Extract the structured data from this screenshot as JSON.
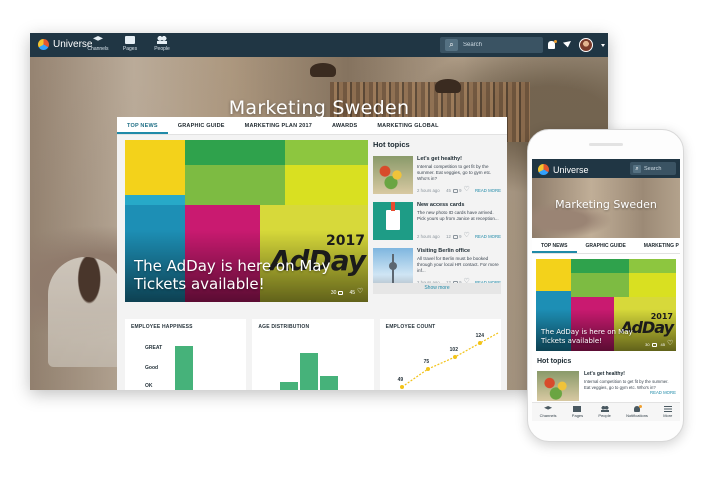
{
  "desktop": {
    "app_name": "Universe",
    "nav": [
      {
        "label": "Channels",
        "icon": "layers-icon"
      },
      {
        "label": "Pages",
        "icon": "book-icon"
      },
      {
        "label": "People",
        "icon": "people-icon"
      }
    ],
    "search": {
      "placeholder": "Search"
    },
    "hero_title": "Marketing Sweden",
    "tabs": [
      {
        "label": "TOP NEWS",
        "active": true
      },
      {
        "label": "GRAPHIC GUIDE"
      },
      {
        "label": "MARKETING PLAN 2017"
      },
      {
        "label": "AWARDS"
      },
      {
        "label": "MARKETING GLOBAL"
      }
    ],
    "feature": {
      "title": "The AdDay is here on May Tickets available!",
      "brand_year": "2017",
      "brand_word": "AdDay",
      "comments": "30",
      "likes": "45"
    },
    "hot_topics": {
      "title": "Hot topics",
      "items": [
        {
          "title": "Let's get healthy!",
          "text": "Internal competition to get fit by the summer. Eat veggies, go to gym etc. Who's in?",
          "time": "2 hours ago",
          "comments": "45",
          "likes": "9",
          "read_more": "READ MORE"
        },
        {
          "title": "New access cards",
          "text": "The new photo ID cards have arrived. Pick yours up from Janice at reception...",
          "time": "2 hours ago",
          "comments": "12",
          "likes": "9",
          "read_more": "READ MORE"
        },
        {
          "title": "Visiting Berlin office",
          "text": "All travel for Berlin must be booked through your local HR contact. For more inf...",
          "time": "2 hours ago",
          "comments": "12",
          "likes": "9",
          "read_more": "READ MORE"
        }
      ],
      "show_more": "Show more"
    },
    "widgets": {
      "happiness": {
        "title": "EMPLOYEE HAPPINESS",
        "labels": [
          "GREAT",
          "Good",
          "OK"
        ]
      },
      "age": {
        "title": "AGE DISTRIBUTION"
      },
      "count": {
        "title": "EMPLOYEE COUNT",
        "values": [
          "49",
          "75",
          "102",
          "124"
        ]
      }
    }
  },
  "phone": {
    "app_name": "Universe",
    "search": {
      "placeholder": "Search"
    },
    "hero_title": "Marketing Sweden",
    "tabs": [
      "TOP NEWS",
      "GRAPHIC GUIDE",
      "MARKETING P"
    ],
    "feature": {
      "title_line1": "The AdDay is here on May",
      "title_line2": "Tickets available!",
      "brand_year": "2017",
      "brand_word": "AdDay",
      "comments": "30",
      "likes": "45"
    },
    "hot_topics": {
      "title": "Hot topics",
      "item": {
        "title": "Let's get healthy!",
        "text": "Internal competition to get fit by the summer. Eat veggies, go to gym etc. Who's in?",
        "read_more": "READ MORE"
      }
    },
    "bottom_nav": [
      "Channels",
      "Pages",
      "People",
      "Notifications",
      "More"
    ]
  },
  "colors": {
    "topbar": "#203644",
    "accent": "#1f8aa8",
    "chart_green": "#46b27a",
    "chart_yellow": "#f2c318"
  }
}
